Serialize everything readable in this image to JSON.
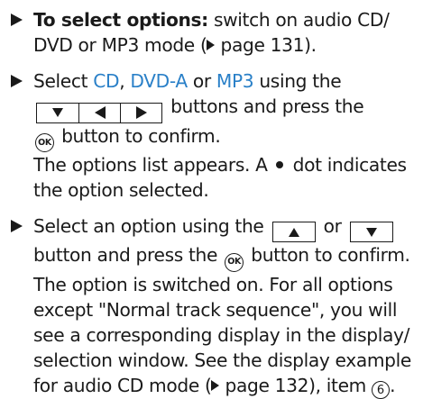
{
  "items": [
    {
      "bold": "To select options:",
      "text_1": " switch on audio CD/ DVD or MP3 mode (",
      "page_ref": " page 131",
      "text_2": ")."
    },
    {
      "text_1": "Select ",
      "mode_cd": "CD",
      "sep_1": ", ",
      "mode_dvda": "DVD-A",
      "sep_2": " or ",
      "mode_mp3": "MP3",
      "text_2": " using the",
      "text_3": " buttons and press the",
      "text_4": " button to confirm.",
      "result_1": "The options list appears. A",
      "result_2": "dot indicates the option selected."
    },
    {
      "text_1": "Select an option using the",
      "or": " or ",
      "text_2": " button and press the",
      "text_3": " button to confirm. The option is switched on. For all options except \"Normal track sequence\", you will see a corresponding display in the display/ selection window. See the display example for audio CD mode (",
      "page_ref": " page 132",
      "text_4": "), item ",
      "item_number": "6",
      "text_5": "."
    }
  ],
  "ok_label": "OK",
  "icons": {
    "bullet": "right-arrow-bullet-icon",
    "page_ref": "small-right-triangle-icon",
    "ok": "ok-button-icon",
    "down": "down-arrow-key-icon",
    "up": "up-arrow-key-icon",
    "left": "left-arrow-key-icon",
    "right": "right-arrow-key-icon",
    "dot": "dot-icon"
  },
  "colors": {
    "mode_text": "#2a80c8",
    "body_text": "#1a1a1a"
  }
}
